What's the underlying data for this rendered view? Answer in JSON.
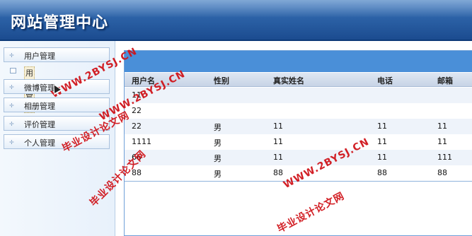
{
  "app": {
    "title": "网站管理中心"
  },
  "sidebar": {
    "items": [
      {
        "label": "用户管理"
      },
      {
        "label": "微博管理"
      },
      {
        "label": "相册管理"
      },
      {
        "label": "评价管理"
      },
      {
        "label": "个人管理"
      }
    ],
    "sub_item": {
      "label": "用户管理"
    }
  },
  "table": {
    "columns": [
      "用户名",
      "性别",
      "真实姓名",
      "电话",
      "邮箱"
    ],
    "rows": [
      [
        "11",
        "",
        "",
        "",
        ""
      ],
      [
        "22",
        "",
        "",
        "",
        ""
      ],
      [
        "22",
        "男",
        "11",
        "11",
        "11"
      ],
      [
        "1111",
        "男",
        "11",
        "11",
        "11"
      ],
      [
        "66",
        "男",
        "11",
        "11",
        "111"
      ],
      [
        "88",
        "男",
        "88",
        "88",
        "88"
      ]
    ]
  },
  "watermarks": {
    "url": "WWW.2BYSJ.CN",
    "site": "毕业设计论文网"
  },
  "colors": {
    "header_bg": "#2d63a8",
    "panel_head": "#4a8fd8",
    "watermark": "#d0141a"
  }
}
